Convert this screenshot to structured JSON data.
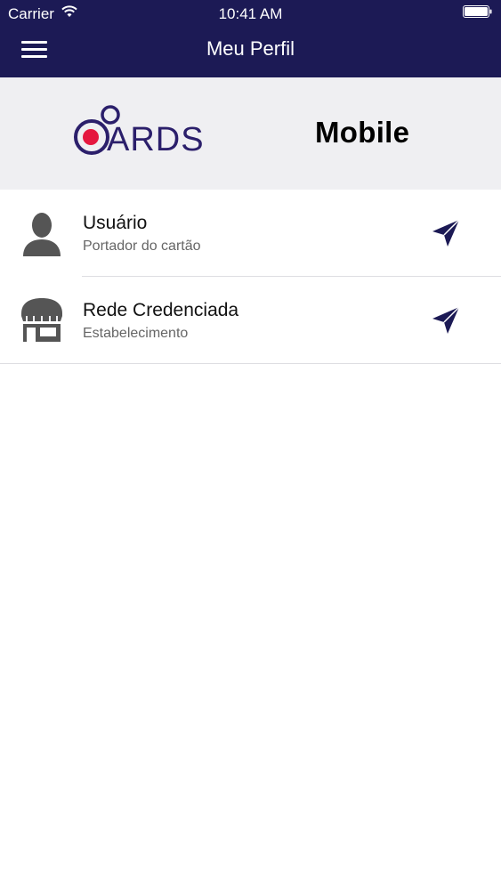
{
  "status_bar": {
    "carrier": "Carrier",
    "time": "10:41 AM",
    "wifi_icon": "wifi-icon",
    "battery_icon": "battery-icon"
  },
  "nav": {
    "title": "Meu Perfil",
    "menu_icon": "hamburger-menu-icon"
  },
  "brand": {
    "logo_text": "CARDS",
    "subtitle": "Mobile"
  },
  "profiles": [
    {
      "title": "Usuário",
      "subtitle": "Portador do cartão",
      "icon": "user-icon",
      "action_icon": "send-icon"
    },
    {
      "title": "Rede Credenciada",
      "subtitle": "Estabelecimento",
      "icon": "store-icon",
      "action_icon": "send-icon"
    }
  ],
  "colors": {
    "nav_bg": "#1c1a55",
    "brand_bg": "#efeff2",
    "logo_purple": "#2b1f6b",
    "logo_red": "#e5173f",
    "icon_gray": "#555555"
  }
}
